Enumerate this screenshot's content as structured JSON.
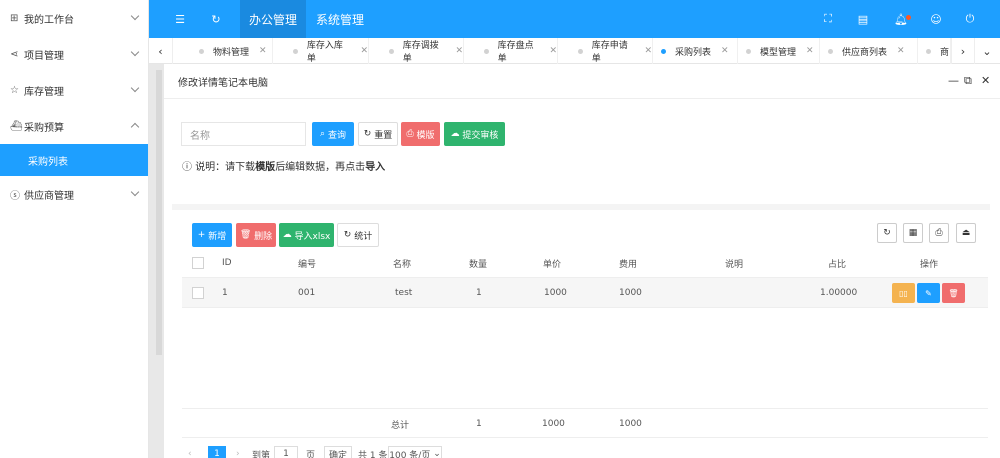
{
  "sidebar": {
    "items": [
      {
        "label": "我的工作台",
        "icon": "windows-icon"
      },
      {
        "label": "项目管理",
        "icon": "share-icon"
      },
      {
        "label": "库存管理",
        "icon": "star-icon"
      },
      {
        "label": "采购预算",
        "icon": "boat-icon"
      },
      {
        "label": "供应商管理",
        "icon": "dollar-icon"
      }
    ],
    "sub_active": "采购列表"
  },
  "header": {
    "nav": [
      "办公管理",
      "系统管理"
    ],
    "active_nav": "办公管理",
    "icons": [
      "menu-toggle-icon",
      "refresh-icon",
      "fullscreen-icon",
      "notes-icon",
      "bell-icon",
      "user-icon",
      "power-icon"
    ]
  },
  "tabs": {
    "items": [
      "物料管理",
      "库存入库单",
      "库存调拨单",
      "库存盘点单",
      "库存申请单",
      "采购列表",
      "模型管理",
      "供应商列表",
      "商"
    ],
    "active": "采购列表"
  },
  "dialog": {
    "title": "修改详情笔记本电脑",
    "search": {
      "placeholder": "名称",
      "query_label": "查询",
      "reset_label": "重置",
      "template_label": "模版",
      "submit_label": "提交审核"
    },
    "note": {
      "prefix": "说明：请下载",
      "bold1": "模版",
      "middle": "后编辑数据，再点击",
      "bold2": "导入"
    },
    "toolbar": {
      "add_label": "新增",
      "delete_label": "删除",
      "import_label": "导入xlsx",
      "stats_label": "统计"
    },
    "table": {
      "columns": [
        "ID",
        "编号",
        "名称",
        "数量",
        "单价",
        "费用",
        "说明",
        "占比",
        "操作"
      ],
      "rows": [
        {
          "id": "1",
          "code": "001",
          "name": "test",
          "qty": "1",
          "price": "1000",
          "cost": "1000",
          "desc": "",
          "ratio": "1.00000"
        }
      ],
      "total": {
        "label": "总计",
        "qty": "1",
        "price": "1000",
        "cost": "1000"
      }
    },
    "pager": {
      "current": "1",
      "goto_prefix": "到第",
      "goto_value": "1",
      "goto_suffix": "页",
      "confirm": "确定",
      "count": "共 1 条",
      "page_size": "100 条/页"
    }
  },
  "colors": {
    "primary": "#1e9fff",
    "danger": "#f06d6d",
    "success": "#2fb46e",
    "warn": "#f4b350"
  }
}
